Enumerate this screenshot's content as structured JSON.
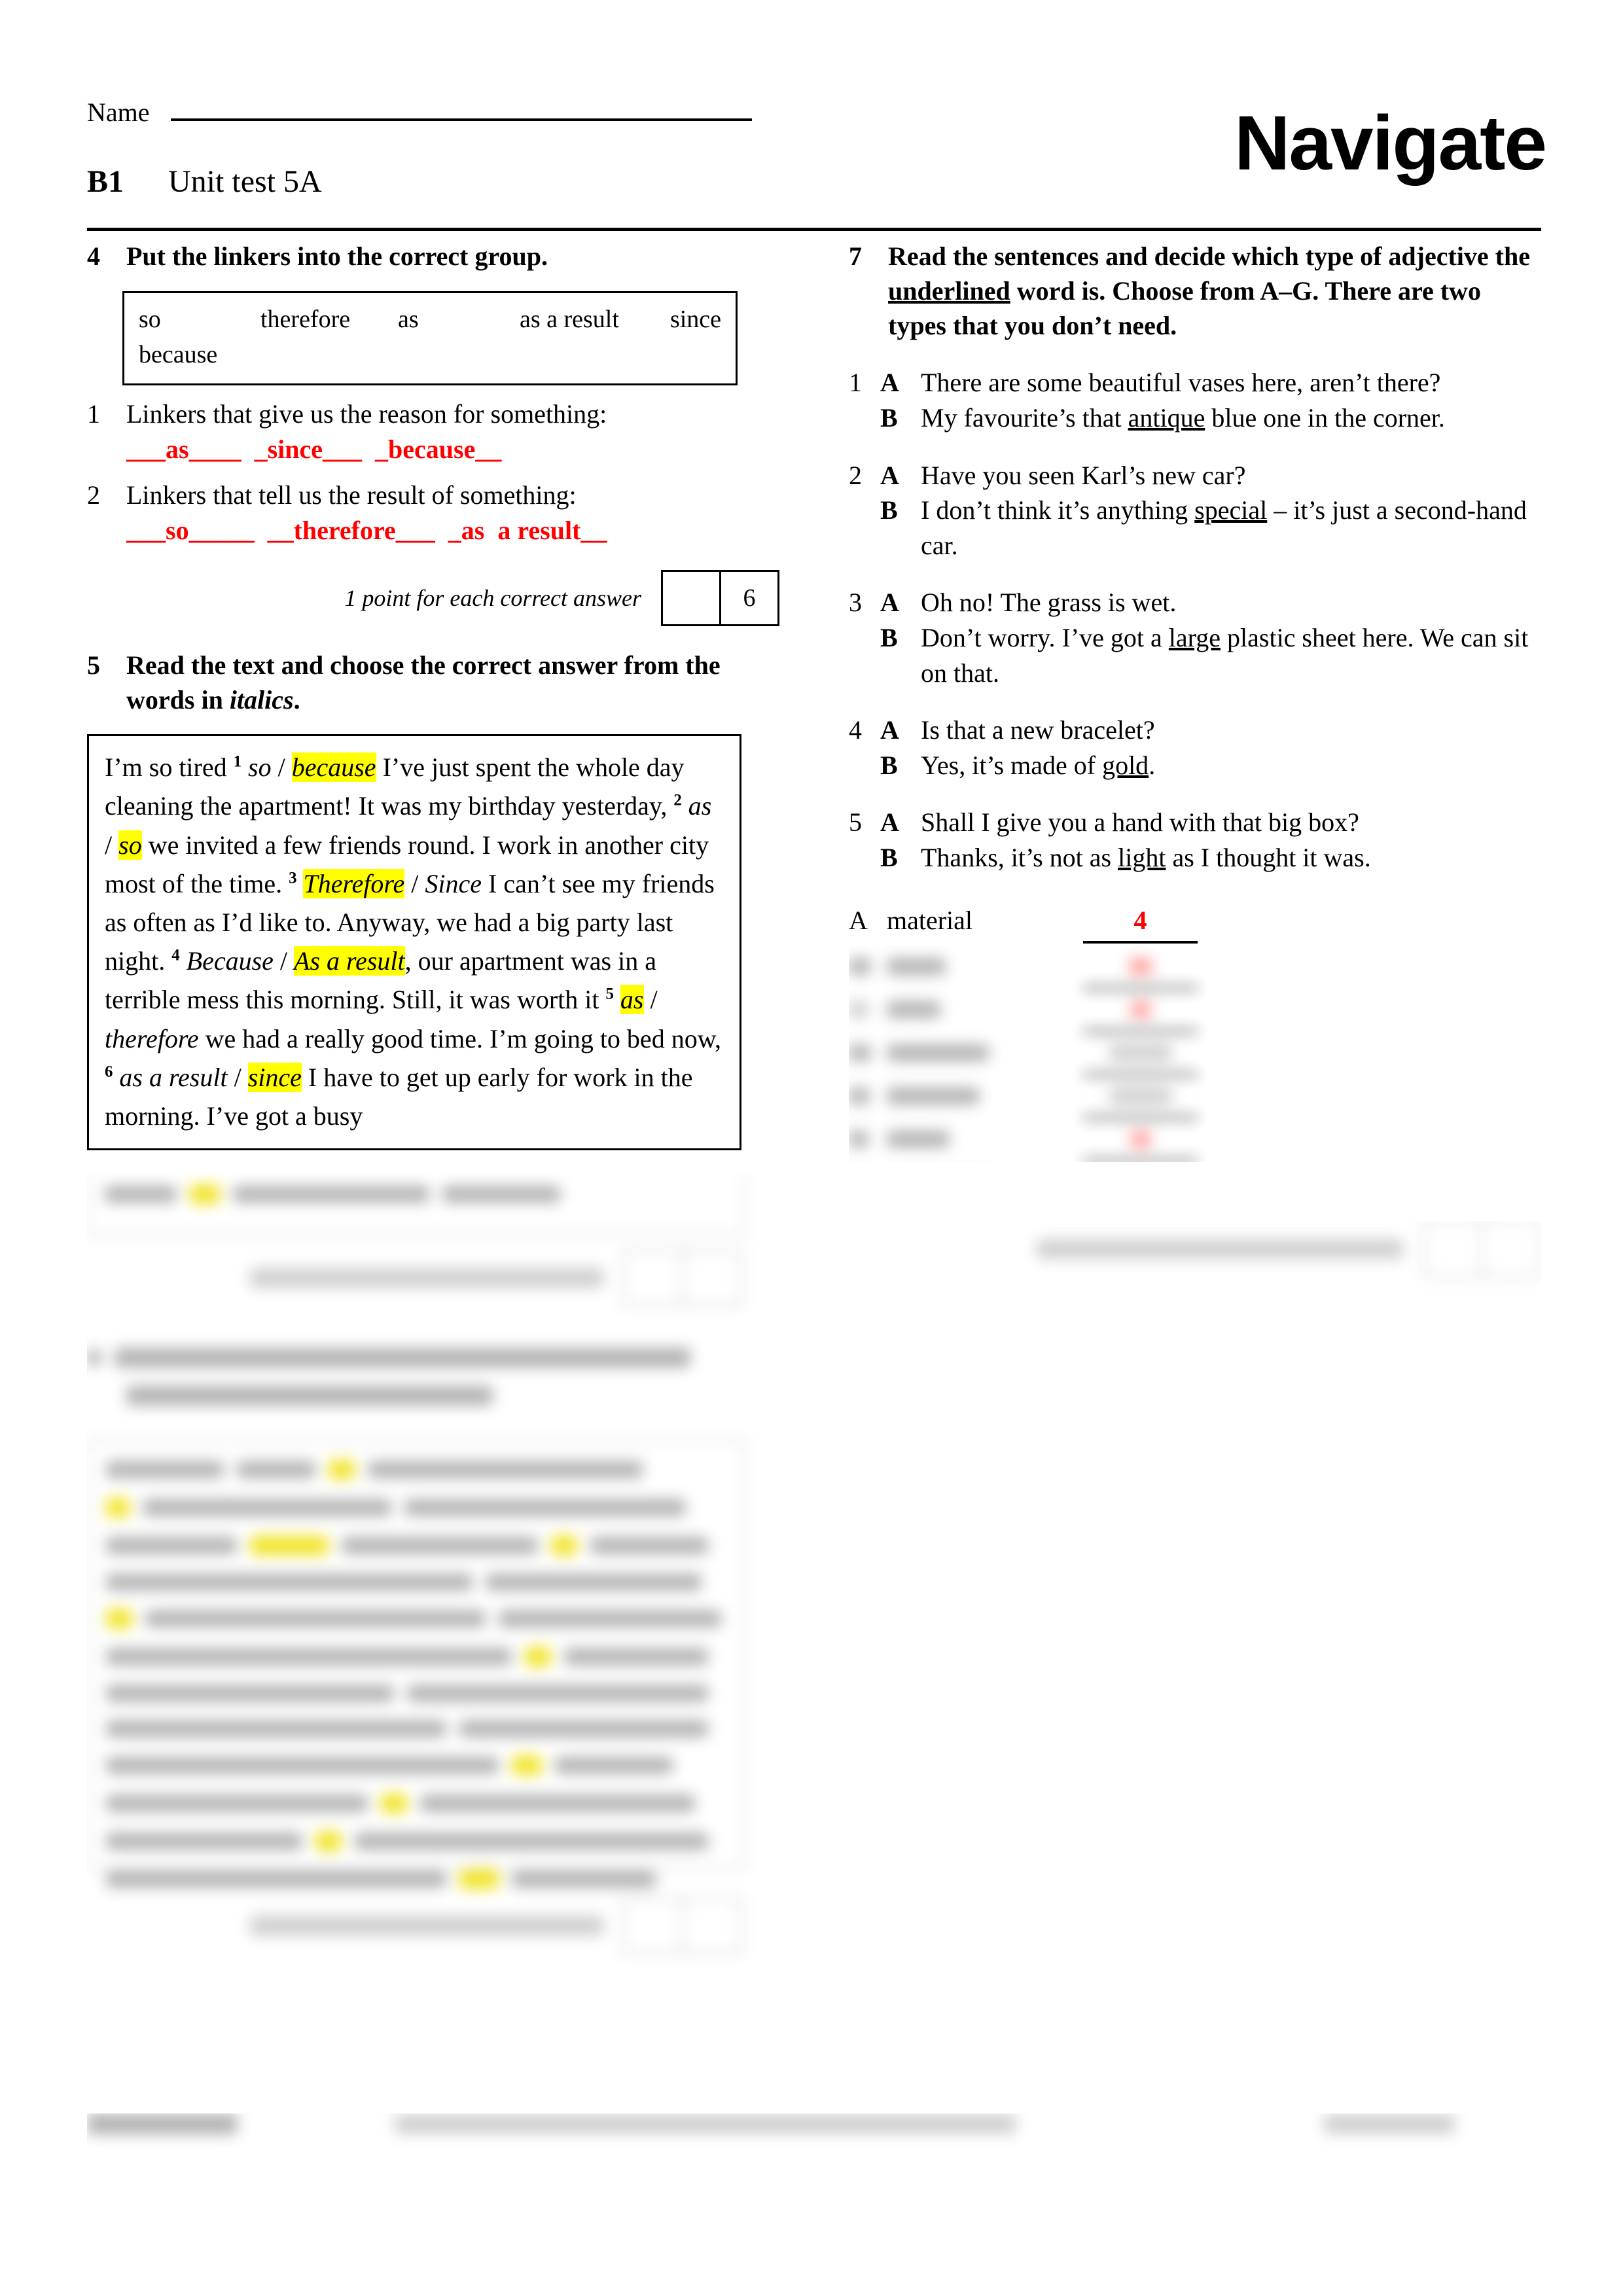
{
  "header": {
    "name_label": "Name",
    "level": "B1",
    "unit_title": "Unit test 5A",
    "brand": "Navigate"
  },
  "exercise4": {
    "number": "4",
    "instruction": "Put the linkers into the correct group.",
    "wordbank": [
      "so",
      "therefore",
      "as",
      "as a result",
      "since",
      "because"
    ],
    "items": [
      {
        "number": "1",
        "prompt": "Linkers that give us the reason for something:",
        "answers": [
          "as",
          "since",
          "because"
        ],
        "answer_line": "___as____  _since___  _because__"
      },
      {
        "number": "2",
        "prompt": "Linkers that tell us the result of something:",
        "answers": [
          "so",
          "therefore",
          "as  a result"
        ],
        "answer_line": "___so_____  __therefore___  _as  a result__"
      }
    ],
    "score_label": "1 point for each correct answer",
    "score_value": "",
    "score_total": "6"
  },
  "exercise5": {
    "number": "5",
    "instruction_part1": "Read the text and choose the correct answer from the words in ",
    "instruction_italic": "italics",
    "instruction_part3": ".",
    "text_runs": [
      {
        "t": "I’m so tired ",
        "s": "plain"
      },
      {
        "t": "1",
        "s": "sup"
      },
      {
        "t": " ",
        "s": "plain"
      },
      {
        "t": "so",
        "s": "italic"
      },
      {
        "t": " / ",
        "s": "plain"
      },
      {
        "t": "because",
        "s": "highlight"
      },
      {
        "t": " I’ve just spent the whole day cleaning the apartment! It was my birthday yesterday, ",
        "s": "plain"
      },
      {
        "t": "2",
        "s": "sup"
      },
      {
        "t": " ",
        "s": "plain"
      },
      {
        "t": "as",
        "s": "italic"
      },
      {
        "t": " / ",
        "s": "plain"
      },
      {
        "t": "so",
        "s": "highlight"
      },
      {
        "t": " we invited a few friends round. I work in another city most of the time. ",
        "s": "plain"
      },
      {
        "t": "3",
        "s": "sup"
      },
      {
        "t": " ",
        "s": "plain"
      },
      {
        "t": "Therefore",
        "s": "highlight"
      },
      {
        "t": " / ",
        "s": "plain"
      },
      {
        "t": "Since",
        "s": "italic"
      },
      {
        "t": " I can’t see my friends as often as I’d like to. Anyway, we had a big party last night. ",
        "s": "plain"
      },
      {
        "t": "4",
        "s": "sup"
      },
      {
        "t": " ",
        "s": "plain"
      },
      {
        "t": "Because",
        "s": "italic"
      },
      {
        "t": " / ",
        "s": "plain"
      },
      {
        "t": "As a result",
        "s": "highlight"
      },
      {
        "t": ", our apartment was in a terrible mess this morning. Still, it was worth it ",
        "s": "plain"
      },
      {
        "t": "5",
        "s": "sup"
      },
      {
        "t": " ",
        "s": "plain"
      },
      {
        "t": "as",
        "s": "highlight"
      },
      {
        "t": " / ",
        "s": "plain"
      },
      {
        "t": "therefore",
        "s": "italic"
      },
      {
        "t": " we had a really good time. I’m going to bed now, ",
        "s": "plain"
      },
      {
        "t": "6",
        "s": "sup"
      },
      {
        "t": " ",
        "s": "plain"
      },
      {
        "t": "as a result",
        "s": "italic"
      },
      {
        "t": " / ",
        "s": "plain"
      },
      {
        "t": "since",
        "s": "highlight"
      },
      {
        "t": " I have to get",
        "s": "plain"
      }
    ],
    "tail_partial": "up early for work in the morning. I’ve got a busy"
  },
  "exercise7": {
    "number": "7",
    "instruction_a": "Read the sentences and decide which type of adjective the ",
    "instruction_u": "underlined",
    "instruction_b": " word is. Choose from A–G. There are two types that you don’t need.",
    "dialogues": [
      {
        "number": "1",
        "lines": [
          {
            "speaker": "A",
            "before": "There are some beautiful vases here, aren’t there?",
            "underline": "",
            "after": ""
          },
          {
            "speaker": "B",
            "before": "My favourite’s that ",
            "underline": "antique",
            "after": " blue one in the corner."
          }
        ]
      },
      {
        "number": "2",
        "lines": [
          {
            "speaker": "A",
            "before": "Have you seen Karl’s new car?",
            "underline": "",
            "after": ""
          },
          {
            "speaker": "B",
            "before": "I don’t think it’s anything ",
            "underline": "special",
            "after": " – it’s just a second-hand car."
          }
        ]
      },
      {
        "number": "3",
        "lines": [
          {
            "speaker": "A",
            "before": "Oh no! The grass is wet.",
            "underline": "",
            "after": ""
          },
          {
            "speaker": "B",
            "before": "Don’t worry. I’ve got a ",
            "underline": "large",
            "after": " plastic sheet here. We can sit on that."
          }
        ]
      },
      {
        "number": "4",
        "lines": [
          {
            "speaker": "A",
            "before": "Is that a new bracelet?",
            "underline": "",
            "after": ""
          },
          {
            "speaker": "B",
            "before": "Yes, it’s made of ",
            "underline": "gold",
            "after": "."
          }
        ]
      },
      {
        "number": "5",
        "lines": [
          {
            "speaker": "A",
            "before": "Shall I give you a hand with that big box?",
            "underline": "",
            "after": ""
          },
          {
            "speaker": "B",
            "before": "Thanks, it’s not as ",
            "underline": "light",
            "after": " as I thought it was."
          }
        ]
      }
    ],
    "options": [
      {
        "letter": "A",
        "word": "material",
        "answer": "4"
      }
    ]
  },
  "colors": {
    "answer_red": "#FF0000",
    "highlight_yellow": "#FFFF00",
    "ink": "#000000"
  }
}
